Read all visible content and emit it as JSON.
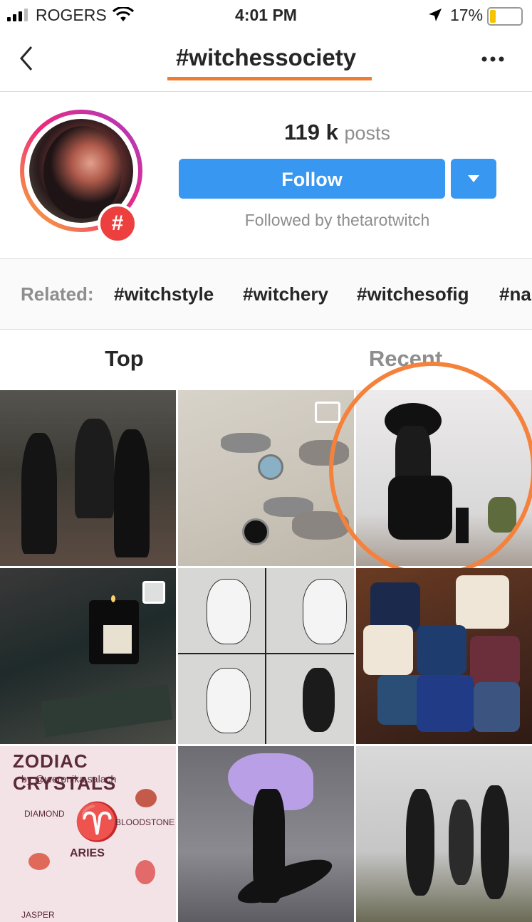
{
  "status_bar": {
    "carrier": "ROGERS",
    "time": "4:01 PM",
    "battery_percent": "17%",
    "icons": [
      "signal-icon",
      "wifi-icon",
      "location-arrow-icon",
      "battery-icon"
    ]
  },
  "nav": {
    "title": "#witchessociety",
    "back_icon": "chevron-left-icon",
    "more_icon": "more-dots-icon"
  },
  "hashtag": {
    "post_count": "119 k",
    "post_label": "posts",
    "follow_label": "Follow",
    "followed_by": "Followed by thetarotwitch"
  },
  "related": {
    "label": "Related:",
    "tags": [
      "#witchstyle",
      "#witchery",
      "#witchesofig",
      "#na"
    ]
  },
  "tabs": {
    "top": "Top",
    "recent": "Recent"
  },
  "grid": {
    "zodiac_title": "ZODIAC CRYSTALS",
    "zodiac_sub": "by @weronika.salach",
    "zodiac_sign": "ARIES",
    "zodiac_diamond": "DIAMOND",
    "zodiac_bloodstone": "BLOODSTONE",
    "zodiac_jasper": "JASPER"
  },
  "colors": {
    "accent_blue": "#3897f0",
    "highlight_orange": "#f5823c",
    "text_primary": "#262626",
    "text_secondary": "#8e8e8e"
  }
}
